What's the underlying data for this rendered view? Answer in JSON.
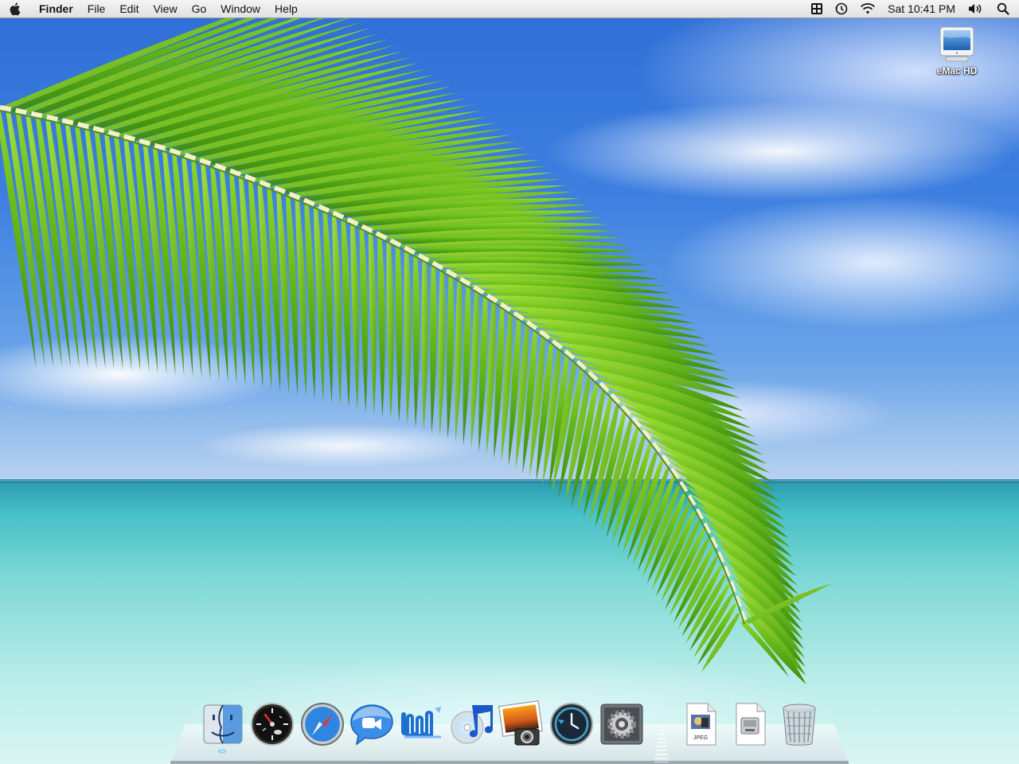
{
  "menubar": {
    "apple_icon": "apple-icon",
    "app_name": "Finder",
    "menus": [
      "File",
      "Edit",
      "View",
      "Go",
      "Window",
      "Help"
    ],
    "status_icons": [
      "fast-user-switch-icon",
      "time-machine-icon",
      "wifi-icon"
    ],
    "clock": "Sat 10:41 PM",
    "volume_icon": "volume-icon",
    "spotlight_icon": "spotlight-search-icon"
  },
  "desktop": {
    "icons": [
      {
        "label": "eMac HD",
        "icon": "hard-drive-monitor-icon"
      }
    ]
  },
  "dock": {
    "apps": [
      {
        "icon": "finder-icon",
        "running": true
      },
      {
        "icon": "dashboard-icon",
        "running": false
      },
      {
        "icon": "safari-icon",
        "running": false
      },
      {
        "icon": "ichat-icon",
        "running": false
      },
      {
        "icon": "iwork-icon",
        "running": false
      },
      {
        "icon": "itunes-icon",
        "running": false
      },
      {
        "icon": "iphoto-icon",
        "running": false
      },
      {
        "icon": "time-machine-icon",
        "running": false
      },
      {
        "icon": "system-preferences-icon",
        "running": false
      }
    ],
    "documents": [
      {
        "icon": "jpeg-document-icon",
        "label": "JPEG"
      },
      {
        "icon": "disk-image-document-icon"
      },
      {
        "icon": "trash-icon"
      }
    ]
  },
  "colors": {
    "menubar_bg": "#e8e8e8",
    "sky": "#3d7fe0",
    "sea": "#7fd9d6",
    "leaf": "#6fc21c"
  }
}
